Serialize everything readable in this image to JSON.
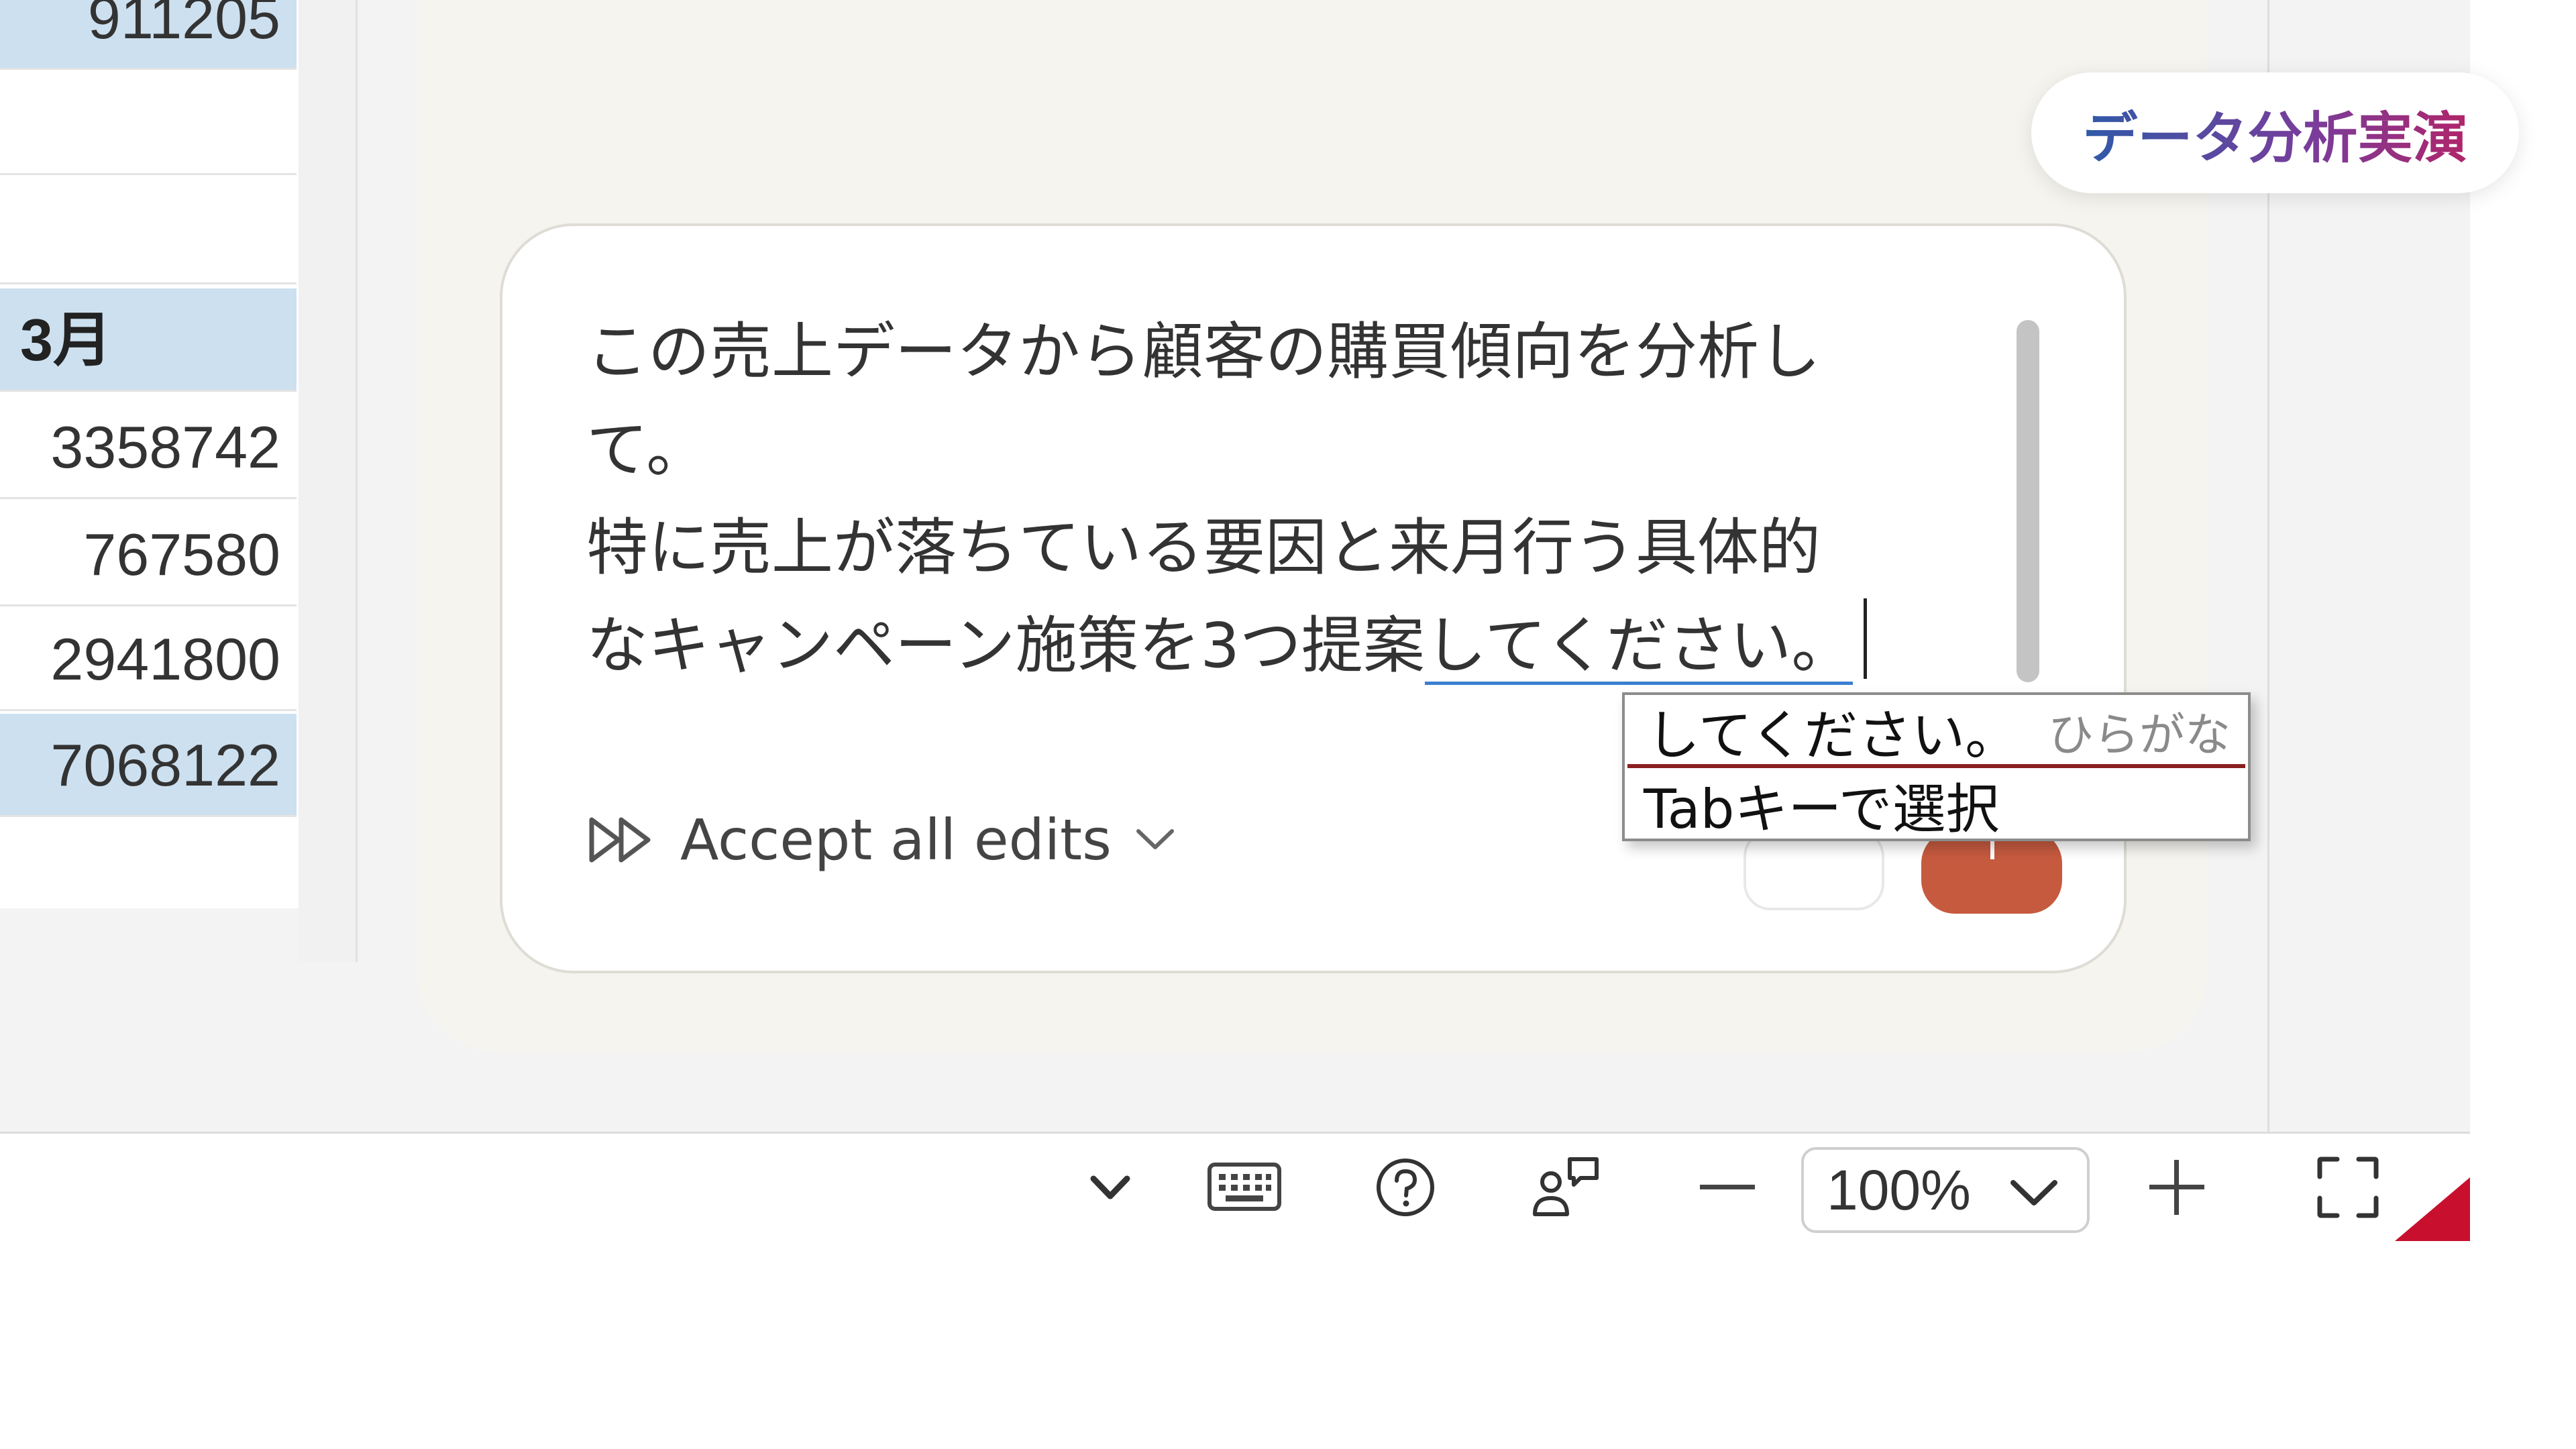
{
  "sheet": {
    "cells": [
      "911205",
      "",
      "",
      "3月",
      "3358742",
      "767580",
      "2941800",
      "7068122",
      ""
    ]
  },
  "badge": {
    "label": "データ分析実演"
  },
  "prompt": {
    "line1": "この売上データから顧客の購買傾向を分析し",
    "line2": "て。",
    "line3": "特に売上が落ちている要因と来月行う具体的",
    "line4_committed": "なキャンペーン施策を3つ提案",
    "line4_composing": "してください。"
  },
  "accept": {
    "label": "Accept all edits"
  },
  "ime": {
    "candidate": "してください。",
    "mode": "ひらがな",
    "hint": "Tabキーで選択"
  },
  "statusbar": {
    "zoom": "100%",
    "icons": [
      "chevron-down-icon",
      "keyboard-icon",
      "help-icon",
      "feedback-icon",
      "zoom-out-icon",
      "zoom-in-icon",
      "fullscreen-icon"
    ]
  },
  "colors": {
    "highlight_cell": "#cde0ef",
    "send_button": "#c65a3f",
    "ime_underline": "#8b1f1f",
    "composition_underline": "#3a7fd1",
    "badge_gradient": [
      "#2f5aa8",
      "#b0256a"
    ]
  }
}
